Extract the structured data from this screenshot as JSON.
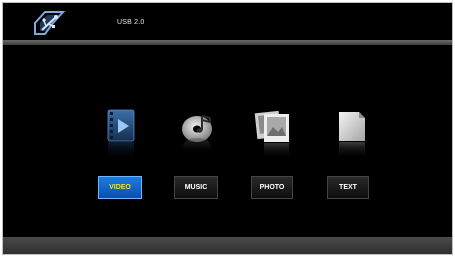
{
  "header": {
    "source_label": "USB 2.0",
    "logo_icon": "usb-logo-icon"
  },
  "menu": {
    "selected": "VIDEO",
    "items": [
      {
        "label": "VIDEO",
        "icon": "video-film-icon"
      },
      {
        "label": "MUSIC",
        "icon": "music-disc-icon"
      },
      {
        "label": "PHOTO",
        "icon": "photo-frames-icon"
      },
      {
        "label": "TEXT",
        "icon": "text-document-icon"
      }
    ]
  },
  "colors": {
    "background": "#000000",
    "selected_button": "#1565c8",
    "selected_label": "#f3e21a",
    "button_label": "#ffffff"
  }
}
